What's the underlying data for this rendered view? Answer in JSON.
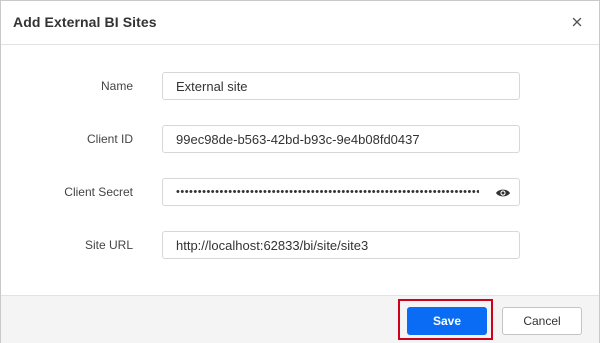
{
  "dialog": {
    "title": "Add External BI Sites",
    "close_icon": "close-icon"
  },
  "form": {
    "name": {
      "label": "Name",
      "value": "External site"
    },
    "client_id": {
      "label": "Client ID",
      "value": "99ec98de-b563-42bd-b93c-9e4b08fd0437"
    },
    "client_secret": {
      "label": "Client Secret",
      "value": "••••••••••••••••••••••••••••••••••••••••••••••••••••••••••••••••••••••••",
      "toggle_icon": "eye-icon"
    },
    "site_url": {
      "label": "Site URL",
      "value": "http://localhost:62833/bi/site/site3"
    }
  },
  "footer": {
    "save_label": "Save",
    "cancel_label": "Cancel"
  },
  "colors": {
    "primary": "#0a6cf5",
    "highlight": "#d0021b",
    "footer_bg": "#f4f4f4"
  }
}
